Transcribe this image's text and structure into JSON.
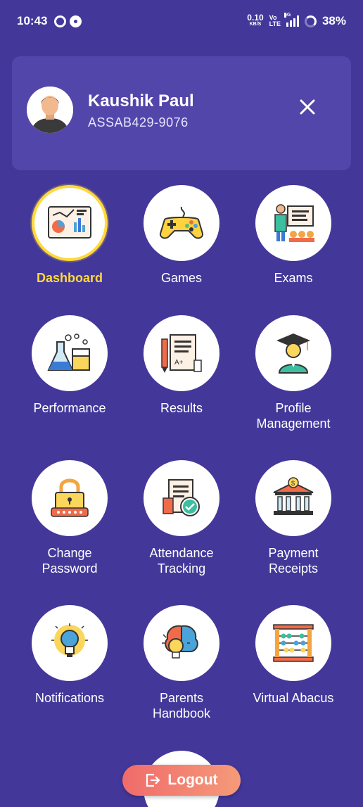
{
  "status_bar": {
    "time": "10:43",
    "net_speed_value": "0.10",
    "net_speed_unit": "KB/S",
    "volte_top": "Vo",
    "volte_bottom": "LTE",
    "network_tag": "5G",
    "battery": "38%"
  },
  "profile": {
    "name": "Kaushik Paul",
    "id": "ASSAB429-9076"
  },
  "menu": [
    {
      "label": "Dashboard",
      "icon": "dashboard-icon",
      "active": true
    },
    {
      "label": "Games",
      "icon": "gamepad-icon"
    },
    {
      "label": "Exams",
      "icon": "exams-icon"
    },
    {
      "label": "Performance",
      "icon": "lab-flask-icon"
    },
    {
      "label": "Results",
      "icon": "results-icon"
    },
    {
      "label": "Profile\nManagement",
      "icon": "graduate-icon"
    },
    {
      "label": "Change\nPassword",
      "icon": "lock-icon"
    },
    {
      "label": "Attendance\nTracking",
      "icon": "attendance-icon"
    },
    {
      "label": "Payment\nReceipts",
      "icon": "bank-icon"
    },
    {
      "label": "Notifications",
      "icon": "lightbulb-icon"
    },
    {
      "label": "Parents\nHandbook",
      "icon": "brain-icon"
    },
    {
      "label": "Virtual Abacus",
      "icon": "abacus-icon"
    }
  ],
  "logout": {
    "label": "Logout"
  },
  "colors": {
    "background": "#43389a",
    "card": "#5346aa",
    "active": "#ffd93b",
    "logout_start": "#f06b6b",
    "logout_end": "#f59a79"
  }
}
